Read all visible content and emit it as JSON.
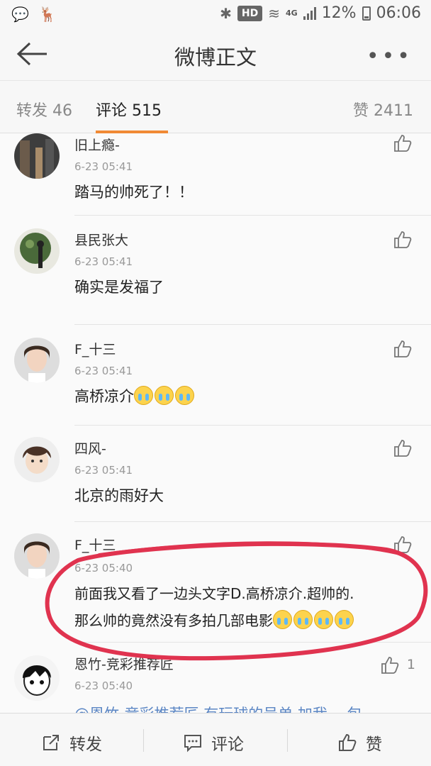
{
  "status_bar": {
    "network": "4G",
    "hd": "HD",
    "battery": "12%",
    "time": "06:06"
  },
  "header": {
    "title": "微博正文"
  },
  "tabs": {
    "repost": "转发 46",
    "comment": "评论 515",
    "like": "赞 2411"
  },
  "comments": [
    {
      "user": "旧上瘾-",
      "time": "6-23 05:41",
      "text": "踏马的帅死了！！"
    },
    {
      "user": "县民张大",
      "time": "6-23 05:41",
      "text": "确实是发福了"
    },
    {
      "user": "F_十三",
      "time": "6-23 05:41",
      "text": "高桥凉介"
    },
    {
      "user": "四风-",
      "time": "6-23 05:41",
      "text": "北京的雨好大"
    },
    {
      "user": "F_十三",
      "time": "6-23 05:40",
      "text_line1": "前面我又看了一边头文字D.高桥凉介.超帅的.",
      "text_line2": "那么帅的竟然没有多拍几部电影"
    },
    {
      "user": "恩竹-竞彩推荐匠",
      "time": "6-23 05:40",
      "like_count": "1",
      "text": "@恩竹-竞彩推荐匠 有玩球的号单 加我 一包"
    }
  ],
  "bottom_bar": {
    "repost": "转发",
    "comment": "评论",
    "like": "赞"
  },
  "colors": {
    "accent_underline": "#f08a35",
    "annotation": "#e0334f",
    "mention": "#5b86c4"
  }
}
